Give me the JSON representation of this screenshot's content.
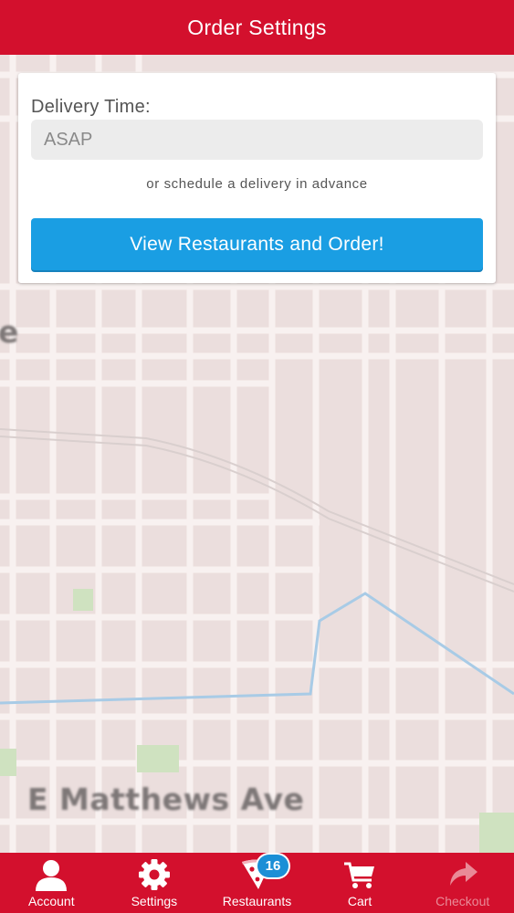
{
  "header": {
    "title": "Order Settings"
  },
  "order_settings": {
    "delivery_time_label": "Delivery Time:",
    "delivery_time_value": "ASAP",
    "schedule_link": "or schedule a delivery in advance",
    "order_button": "View Restaurants and Order!"
  },
  "map": {
    "street_label": "E Matthews Ave",
    "partial_label": "e"
  },
  "tabbar": {
    "items": [
      {
        "label": "Account",
        "icon": "person-icon"
      },
      {
        "label": "Settings",
        "icon": "gear-icon"
      },
      {
        "label": "Restaurants",
        "icon": "pizza-slice-icon"
      },
      {
        "label": "Cart",
        "icon": "cart-icon"
      },
      {
        "label": "Checkout",
        "icon": "share-arrow-icon",
        "disabled": true
      }
    ],
    "restaurants_badge": "16"
  },
  "colors": {
    "brand_red": "#d3102d",
    "button_blue": "#1a9ee3",
    "badge_blue": "#1b8fd6"
  }
}
